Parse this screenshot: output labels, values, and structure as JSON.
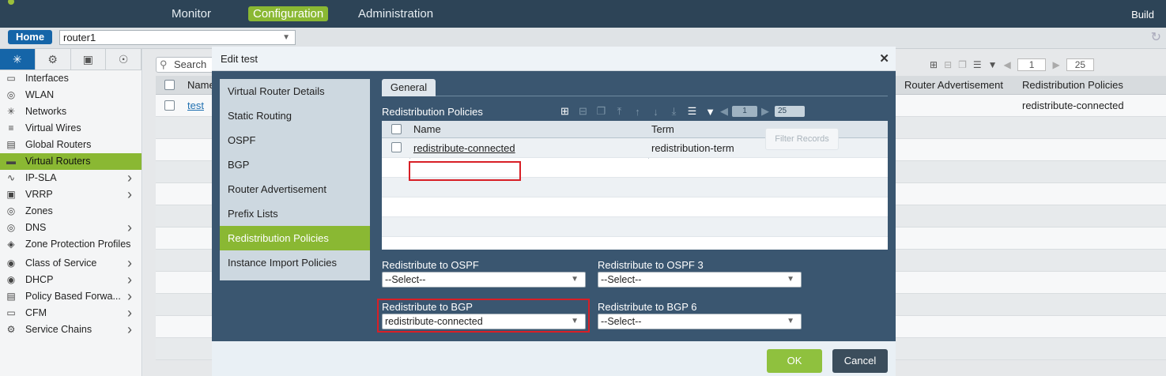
{
  "header": {
    "nav": [
      "Monitor",
      "Configuration",
      "Administration"
    ],
    "active_nav": "Configuration",
    "build_label": "Build"
  },
  "subbar": {
    "home_label": "Home",
    "router_value": "router1"
  },
  "sidebar": {
    "tab_icons": [
      "network-icon",
      "gear-icon",
      "cube-icon",
      "globe-gear-icon"
    ],
    "items": [
      {
        "label": "Interfaces",
        "icon": "interfaces-icon",
        "has_arrow": false,
        "active": false
      },
      {
        "label": "WLAN",
        "icon": "wlan-icon",
        "has_arrow": false,
        "active": false
      },
      {
        "label": "Networks",
        "icon": "networks-icon",
        "has_arrow": false,
        "active": false
      },
      {
        "label": "Virtual Wires",
        "icon": "virtual-wires-icon",
        "has_arrow": false,
        "active": false
      },
      {
        "label": "Global Routers",
        "icon": "global-routers-icon",
        "has_arrow": false,
        "active": false
      },
      {
        "label": "Virtual Routers",
        "icon": "virtual-routers-icon",
        "has_arrow": false,
        "active": true
      },
      {
        "label": "IP-SLA",
        "icon": "ip-sla-icon",
        "has_arrow": true,
        "active": false
      },
      {
        "label": "VRRP",
        "icon": "vrrp-icon",
        "has_arrow": true,
        "active": false
      },
      {
        "label": "Zones",
        "icon": "zones-icon",
        "has_arrow": false,
        "active": false
      },
      {
        "label": "DNS",
        "icon": "dns-icon",
        "has_arrow": true,
        "active": false
      },
      {
        "label": "Zone Protection Profiles",
        "icon": "zone-protection-icon",
        "has_arrow": false,
        "active": false
      },
      {
        "label": "Class of Service",
        "icon": "class-of-service-icon",
        "has_arrow": true,
        "active": false
      },
      {
        "label": "DHCP",
        "icon": "dhcp-icon",
        "has_arrow": true,
        "active": false
      },
      {
        "label": "Policy Based Forwa...",
        "icon": "policy-forwarding-icon",
        "has_arrow": true,
        "active": false
      },
      {
        "label": "CFM",
        "icon": "cfm-icon",
        "has_arrow": true,
        "active": false
      },
      {
        "label": "Service Chains",
        "icon": "service-chains-icon",
        "has_arrow": true,
        "active": false
      }
    ]
  },
  "main": {
    "search_placeholder": "Search",
    "columns": [
      "Name",
      "Router Advertisement",
      "Redistribution Policies"
    ],
    "rows": [
      {
        "name": "test",
        "redistribution_policies": "redistribute-connected"
      }
    ],
    "page_number": "1",
    "page_size": "25"
  },
  "dialog": {
    "title": "Edit test",
    "left_menu": [
      "Virtual Router Details",
      "Static Routing",
      "OSPF",
      "BGP",
      "Router Advertisement",
      "Prefix Lists",
      "Redistribution Policies",
      "Instance Import Policies"
    ],
    "active_menu": "Redistribution Policies",
    "tab": "General",
    "section_title": "Redistribution Policies",
    "grid": {
      "columns": [
        "Name",
        "Term"
      ],
      "rows": [
        {
          "name": "redistribute-connected",
          "term": "redistribution-term"
        }
      ],
      "page_number": "1",
      "page_size": "25",
      "filter_tooltip": "Filter Records"
    },
    "fields": {
      "ospf_label": "Redistribute to OSPF",
      "ospf_value": "--Select--",
      "ospf3_label": "Redistribute to OSPF 3",
      "ospf3_value": "--Select--",
      "bgp_label": "Redistribute to BGP",
      "bgp_value": "redistribute-connected",
      "bgp6_label": "Redistribute to BGP 6",
      "bgp6_value": "--Select--"
    },
    "ok_label": "OK",
    "cancel_label": "Cancel"
  },
  "colors": {
    "topbar": "#2d4457",
    "accent_green": "#8ab833",
    "home_blue": "#1565a8",
    "dialog_body": "#3a5670",
    "highlight_red": "#d81f26"
  }
}
